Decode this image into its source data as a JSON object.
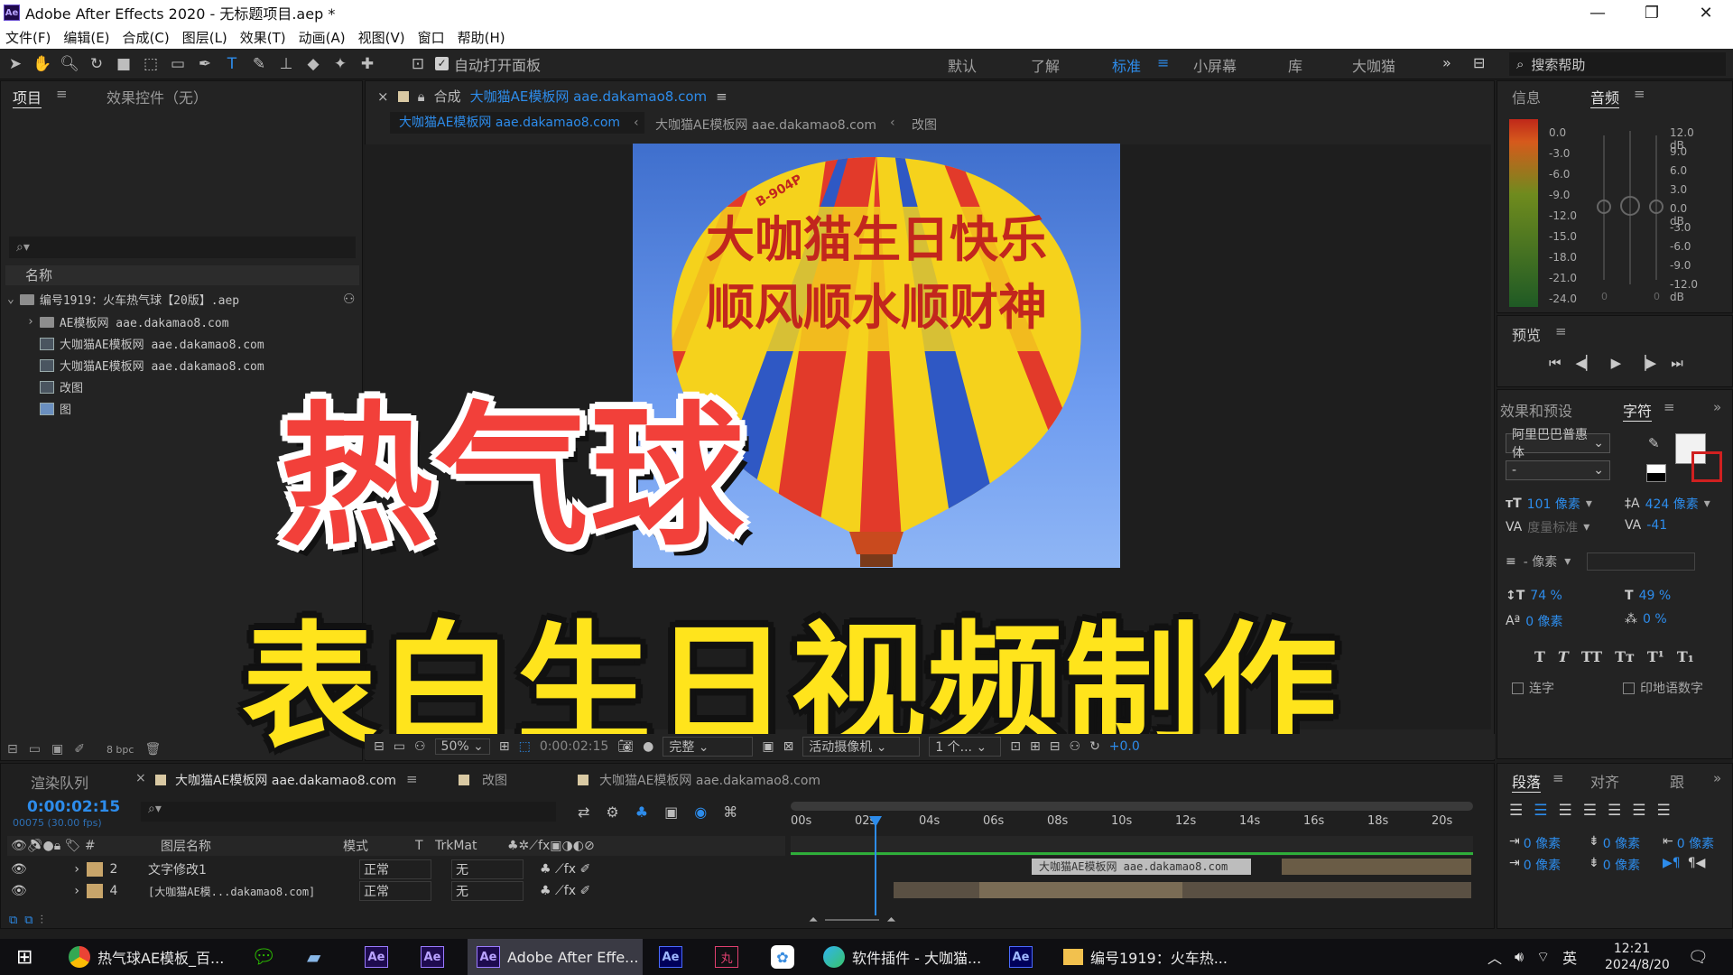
{
  "app": {
    "title": "Adobe After Effects 2020 - 无标题项目.aep *",
    "logo": "Ae"
  },
  "menu": [
    "文件(F)",
    "编辑(E)",
    "合成(C)",
    "图层(L)",
    "效果(T)",
    "动画(A)",
    "视图(V)",
    "窗口",
    "帮助(H)"
  ],
  "toolbar": {
    "auto_open_label": "自动打开面板",
    "workspaces": [
      "默认",
      "了解",
      "标准",
      "小屏幕",
      "库",
      "大咖猫"
    ],
    "active_workspace": "标准",
    "search_placeholder": "搜索帮助"
  },
  "project_panel": {
    "tab_project": "项目",
    "tab_effects": "效果控件（无）",
    "column_name": "名称",
    "items": [
      "编号1919：火车热气球【20版】.aep",
      "AE模板网 aae.dakamao8.com",
      "大咖猫AE模板网 aae.dakamao8.com",
      "大咖猫AE模板网 aae.dakamao8.com",
      "改图",
      "图"
    ],
    "bpc": "8 bpc"
  },
  "composition": {
    "tab_prefix": "合成",
    "tab_name": "大咖猫AE模板网 aae.dakamao8.com",
    "breadcrumbs": [
      "大咖猫AE模板网 aae.dakamao8.com",
      "大咖猫AE模板网 aae.dakamao8.com",
      "改图"
    ],
    "balloon_text_line1": "大咖猫生日快乐",
    "balloon_text_line2": "顺风顺水顺财神",
    "balloon_tag": "B-904P",
    "zoom": "50%",
    "timecode": "0:00:02:15",
    "quality": "完整",
    "camera": "活动摄像机",
    "views": "1 个...",
    "exposure": "+0.0"
  },
  "overlay": {
    "line1": "热气球",
    "line2": "表白生日视频制作"
  },
  "info_panel": {
    "tab_info": "信息",
    "tab_audio": "音频",
    "left_scale": [
      "0.0",
      "-3.0",
      "-6.0",
      "-9.0",
      "-12.0",
      "-15.0",
      "-18.0",
      "-21.0",
      "-24.0"
    ],
    "right_scale": [
      "12.0 dB",
      "9.0",
      "6.0",
      "3.0",
      "0.0 dB",
      "-3.0",
      "-6.0",
      "-9.0",
      "-12.0 dB"
    ],
    "slider_zero_left": "0",
    "slider_zero_right": "0"
  },
  "preview_panel": {
    "title": "预览"
  },
  "character_panel": {
    "tab_effects": "效果和预设",
    "tab_character": "字符",
    "font": "阿里巴巴普惠体",
    "style": "-",
    "size": "101 像素",
    "leading": "424 像素",
    "kerning": "度量标准",
    "tracking": "-41",
    "stroke": "- 像素",
    "vscale": "74 %",
    "hscale": "49 %",
    "baseline": "0 像素",
    "tsume": "0 %",
    "ligature_label": "连字",
    "hindi_label": "印地语数字"
  },
  "paragraph_panel": {
    "tab_paragraph": "段落",
    "tab_align": "对齐",
    "tab_track": "跟",
    "indent1": "0 像素",
    "indent2": "0 像素",
    "space1": "0 像素",
    "space2": "0 像素",
    "indent3": "0 像素"
  },
  "timeline": {
    "tab_render": "渲染队列",
    "tab_comp": "大咖猫AE模板网 aae.dakamao8.com",
    "tab_gaitu": "改图",
    "tab_comp2": "大咖猫AE模板网 aae.dakamao8.com",
    "timecode": "0:00:02:15",
    "frame_info": "00075 (30.00 fps)",
    "col_layer": "图层名称",
    "col_mode": "模式",
    "col_t": "T",
    "col_trkmat": "TrkMat",
    "ruler": [
      "00s",
      "02s",
      "04s",
      "06s",
      "08s",
      "10s",
      "12s",
      "14s",
      "16s",
      "18s",
      "20s"
    ],
    "layers": [
      {
        "num": "2",
        "name": "文字修改1",
        "mode": "正常",
        "trk": "无"
      },
      {
        "num": "4",
        "name": "[大咖猫AE模...dakamao8.com]",
        "mode": "正常",
        "trk": "无"
      }
    ],
    "bar_label": "大咖猫AE模板网 aae.dakamao8.com"
  },
  "taskbar": {
    "items": [
      "热气球AE模板_百...",
      "Adobe After Effe...",
      "软件插件 - 大咖猫...",
      "编号1919：火车热..."
    ],
    "lang": "英",
    "time": "12:21",
    "date": "2024/8/20"
  },
  "colors": {
    "accent": "#2d8ceb",
    "headline_red": "#f2403a",
    "headline_yellow": "#ffe41c",
    "timeline_green": "#2fae3a"
  }
}
